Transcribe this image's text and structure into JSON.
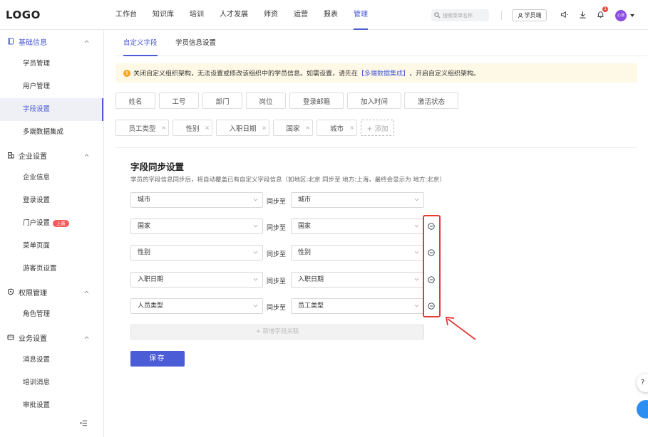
{
  "header": {
    "logo": "LOGO",
    "nav": [
      "工作台",
      "知识库",
      "培训",
      "人才发展",
      "师资",
      "运营",
      "报表",
      "管理"
    ],
    "active_nav": "管理",
    "search_placeholder": "搜索菜单名称",
    "student_button": "学员端",
    "notification_count": "1",
    "avatar_text": "心测",
    "accent_color": "#4a5dd6"
  },
  "sidebar": {
    "groups": [
      {
        "label": "基础信息",
        "items": [
          "学员管理",
          "用户管理",
          "字段设置",
          "多端数据集成"
        ]
      },
      {
        "label": "企业设置",
        "items": [
          "企业信息",
          "登录设置",
          "门户设置",
          "菜单页面",
          "游客页设置"
        ]
      },
      {
        "label": "权限管理",
        "items": [
          "角色管理"
        ]
      },
      {
        "label": "业务设置",
        "items": [
          "消息设置",
          "培训消息",
          "审批设置"
        ]
      }
    ],
    "active_item": "字段设置",
    "new_badge": "上新"
  },
  "tabs": [
    "自定义字段",
    "学员信息设置"
  ],
  "notice": {
    "text_before": "关闭自定义组织架构，无法设置或修改该组织中的学员信息。如需设置，请先在",
    "link": "【多端数据集成】",
    "text_after": "，开启自定义组织架构。"
  },
  "fixed_fields": [
    "姓名",
    "工号",
    "部门",
    "岗位",
    "登录邮箱",
    "加入时间",
    "激活状态"
  ],
  "custom_fields": [
    "员工类型",
    "性别",
    "入职日期",
    "国家",
    "城市"
  ],
  "add_field": "+ 添加",
  "sync": {
    "title": "字段同步设置",
    "description": "学员的字段信息同步后，将自动覆盖已有自定义字段信息（如地区:北京 同步至 地方:上海，最终会显示为 地方:北京）",
    "sync_label": "同步至",
    "rows": [
      {
        "source": "城市",
        "target": "城市",
        "removable": false
      },
      {
        "source": "国家",
        "target": "国家",
        "removable": true
      },
      {
        "source": "性别",
        "target": "性别",
        "removable": true
      },
      {
        "source": "入职日期",
        "target": "入职日期",
        "removable": true
      },
      {
        "source": "人员类型",
        "target": "员工类型",
        "removable": true
      }
    ],
    "add_association": "+ 新增字段关联",
    "save": "保存"
  },
  "float": {
    "help": "?"
  }
}
